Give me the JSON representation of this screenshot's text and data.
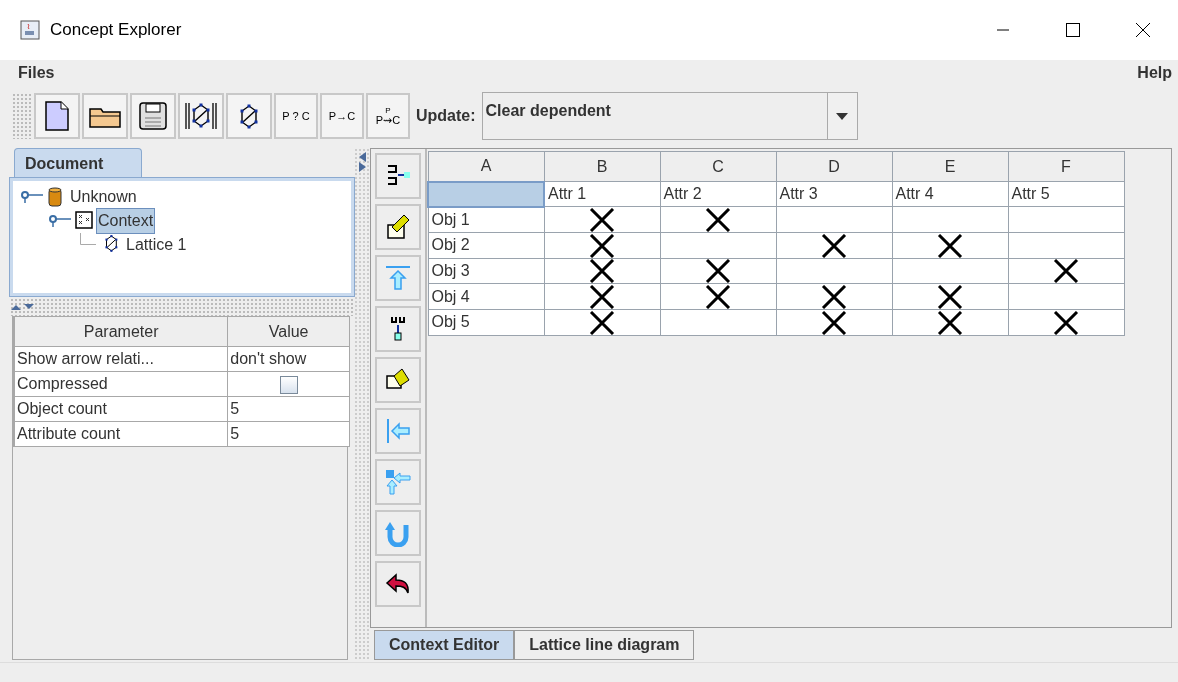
{
  "window": {
    "title": "Concept Explorer"
  },
  "menu": {
    "left": "Files",
    "right": "Help"
  },
  "toolbar": {
    "text_buttons": [
      {
        "label": "P ? C"
      },
      {
        "label": "P→C"
      },
      {
        "label": "P⇝C",
        "over": "P"
      }
    ],
    "update_label": "Update:",
    "update_value": "Clear dependent"
  },
  "document_tab": {
    "label": "Document",
    "selected": true
  },
  "tree": [
    {
      "label": "Unknown",
      "expanded": true,
      "selected": false,
      "children": [
        {
          "label": "Context",
          "expanded": true,
          "selected": true,
          "children": [
            {
              "label": "Lattice 1",
              "selected": false
            }
          ]
        }
      ]
    }
  ],
  "parameters": {
    "columns": [
      "Parameter",
      "Value"
    ],
    "rows": [
      {
        "name": "Show arrow relati...",
        "kind": "text",
        "value": "don't show"
      },
      {
        "name": "Compressed",
        "kind": "checkbox",
        "checked": false
      },
      {
        "name": "Object count",
        "kind": "text",
        "value": "5"
      },
      {
        "name": "Attribute count",
        "kind": "text",
        "value": "5"
      }
    ]
  },
  "context": {
    "columns": [
      "A",
      "B",
      "C",
      "D",
      "E",
      "F"
    ],
    "attributes": [
      "Attr 1",
      "Attr 2",
      "Attr 3",
      "Attr 4",
      "Attr 5"
    ],
    "rows": [
      {
        "object": "Obj 1",
        "crosses": [
          true,
          true,
          false,
          false,
          false
        ]
      },
      {
        "object": "Obj 2",
        "crosses": [
          true,
          false,
          true,
          true,
          false
        ]
      },
      {
        "object": "Obj 3",
        "crosses": [
          true,
          true,
          false,
          false,
          true
        ]
      },
      {
        "object": "Obj 4",
        "crosses": [
          true,
          true,
          true,
          true,
          false
        ]
      },
      {
        "object": "Obj 5",
        "crosses": [
          true,
          false,
          true,
          true,
          true
        ]
      }
    ]
  },
  "bottom_tabs": [
    {
      "label": "Context Editor",
      "selected": true
    },
    {
      "label": "Lattice line diagram",
      "selected": false
    }
  ]
}
